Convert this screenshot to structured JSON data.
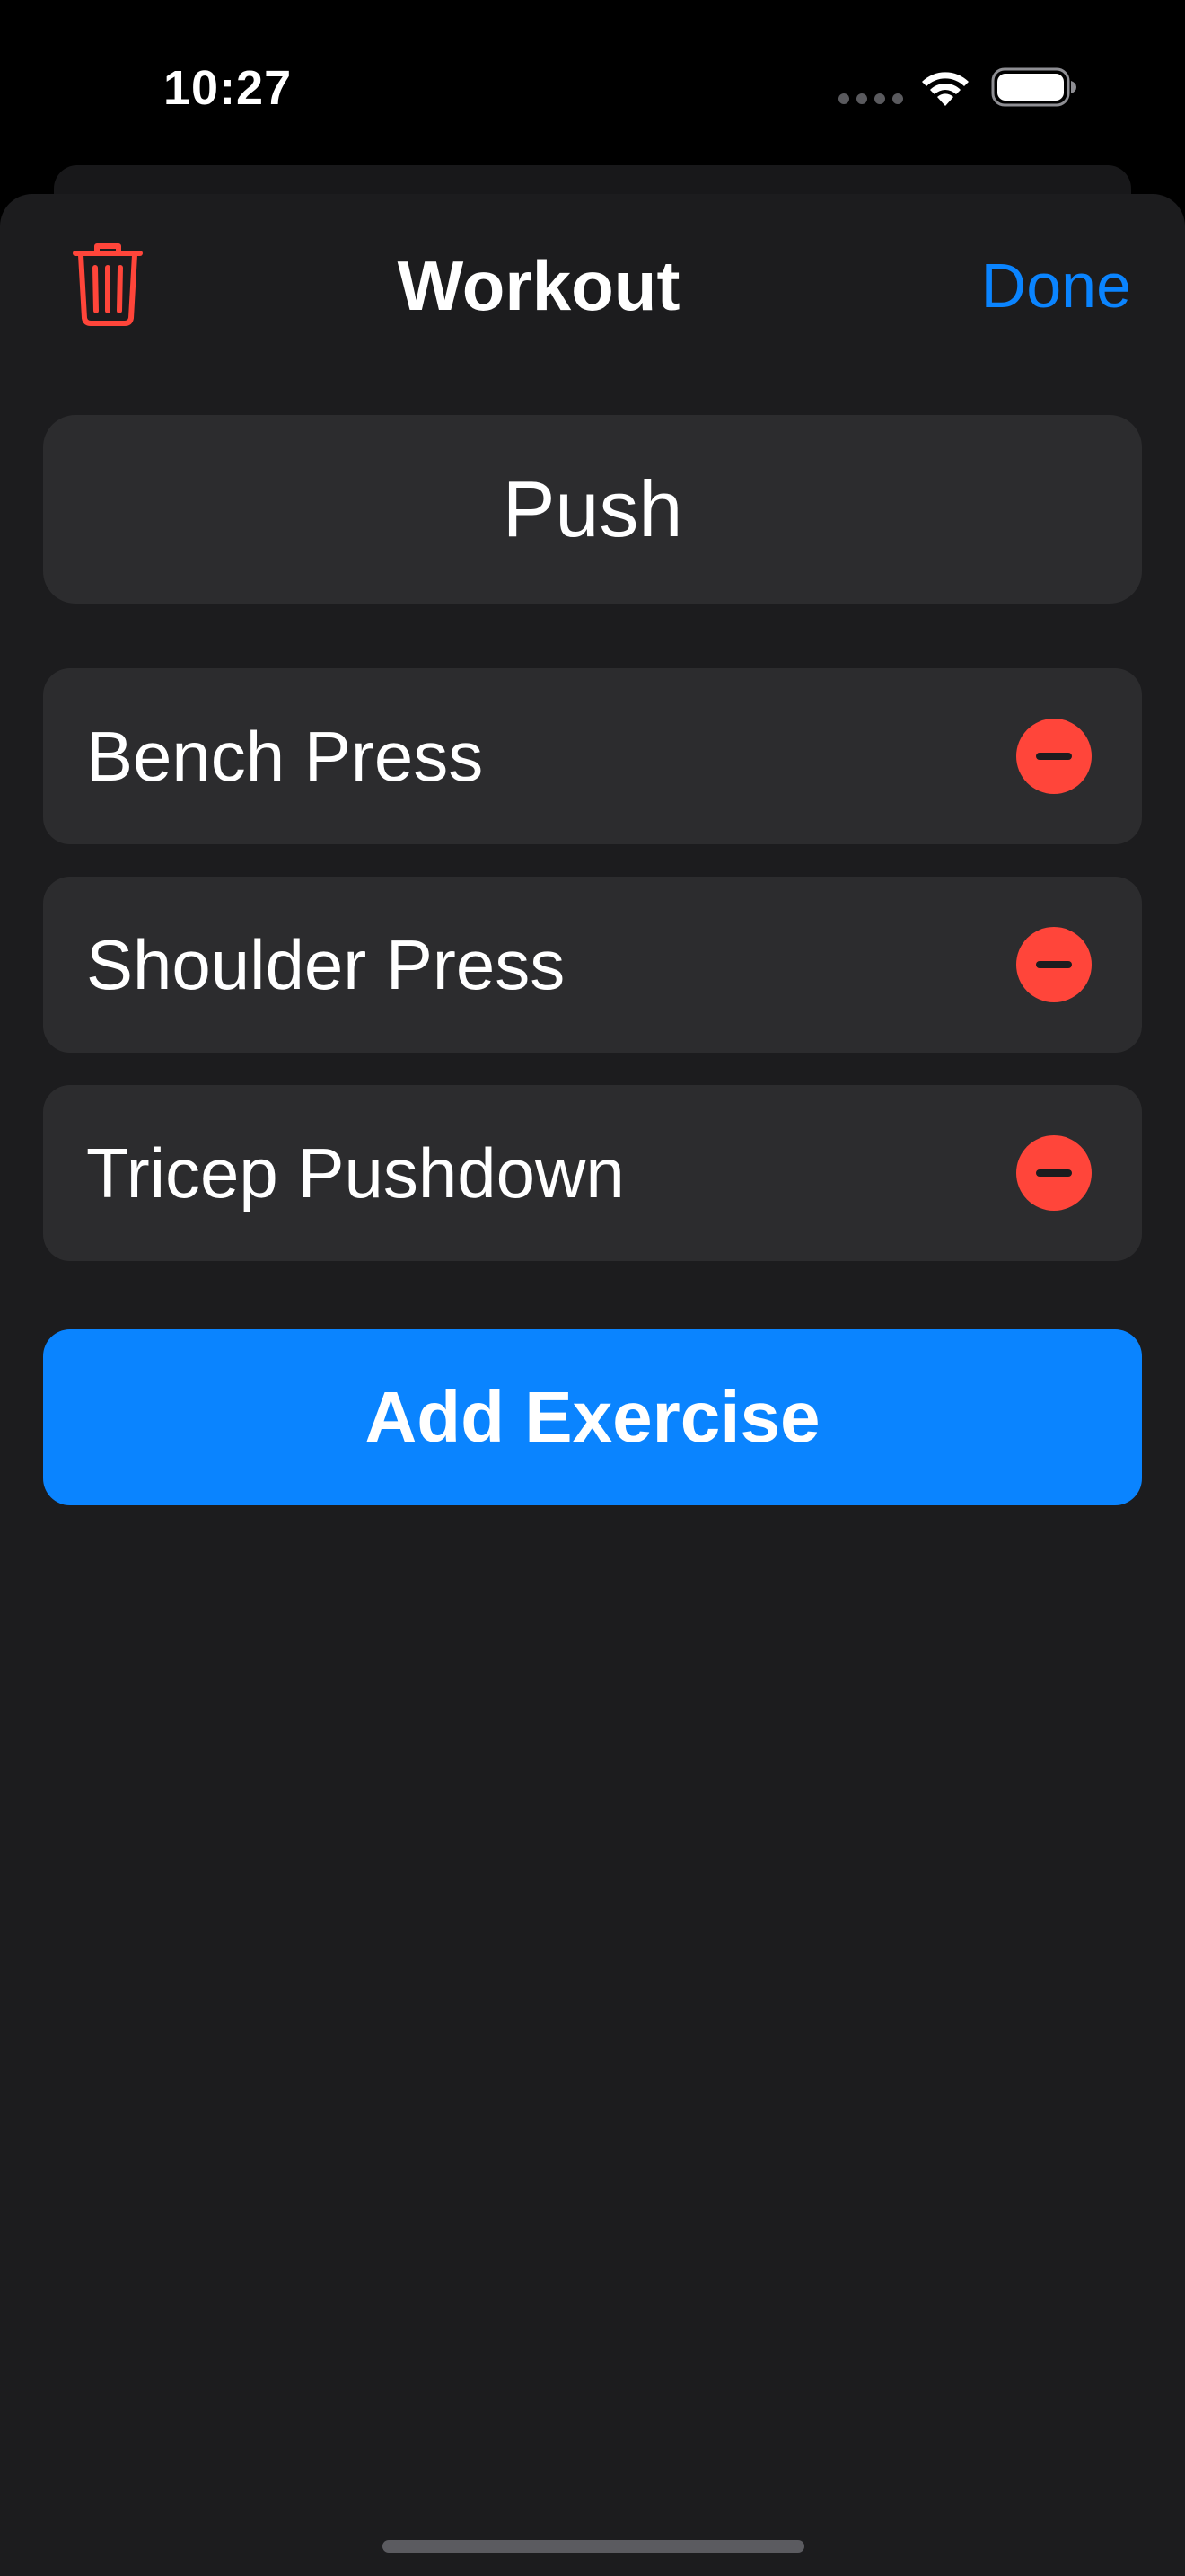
{
  "status_bar": {
    "time": "10:27"
  },
  "header": {
    "title": "Workout",
    "done_label": "Done",
    "trash_icon": "trash-icon"
  },
  "workout": {
    "name": "Push"
  },
  "exercises": [
    {
      "name": "Bench Press"
    },
    {
      "name": "Shoulder Press"
    },
    {
      "name": "Tricep Pushdown"
    }
  ],
  "add_button": {
    "label": "Add Exercise"
  },
  "colors": {
    "background": "#1c1c1e",
    "card": "#2c2c2e",
    "accent": "#0a84ff",
    "destructive": "#ff453a"
  }
}
